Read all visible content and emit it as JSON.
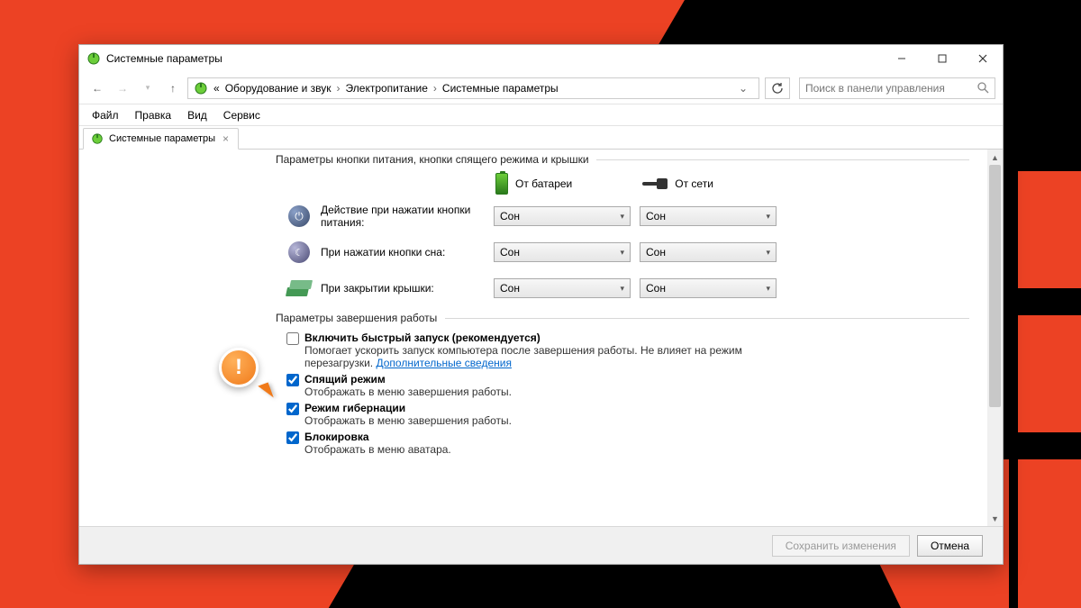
{
  "window": {
    "title": "Системные параметры"
  },
  "breadcrumb": {
    "prefix": "«",
    "items": [
      "Оборудование и звук",
      "Электропитание",
      "Системные параметры"
    ],
    "search_placeholder": "Поиск в панели управления"
  },
  "menu": [
    "Файл",
    "Правка",
    "Вид",
    "Сервис"
  ],
  "tab": {
    "label": "Системные параметры"
  },
  "section1": {
    "title": "Параметры кнопки питания, кнопки спящего режима и крышки",
    "col_battery": "От батареи",
    "col_plugged": "От сети",
    "rows": [
      {
        "label": "Действие при нажатии кнопки питания:",
        "battery": "Сон",
        "plugged": "Сон"
      },
      {
        "label": "При нажатии кнопки сна:",
        "battery": "Сон",
        "plugged": "Сон"
      },
      {
        "label": "При закрытии крышки:",
        "battery": "Сон",
        "plugged": "Сон"
      }
    ]
  },
  "section2": {
    "title": "Параметры завершения работы",
    "items": [
      {
        "title": "Включить быстрый запуск (рекомендуется)",
        "desc": "Помогает ускорить запуск компьютера после завершения работы. Не влияет на режим перезагрузки. ",
        "link": "Дополнительные сведения",
        "checked": false
      },
      {
        "title": "Спящий режим",
        "desc": "Отображать в меню завершения работы.",
        "checked": true
      },
      {
        "title": "Режим гибернации",
        "desc": "Отображать в меню завершения работы.",
        "checked": true
      },
      {
        "title": "Блокировка",
        "desc": "Отображать в меню аватара.",
        "checked": true
      }
    ]
  },
  "footer": {
    "save": "Сохранить изменения",
    "cancel": "Отмена"
  },
  "callout_text": "!"
}
